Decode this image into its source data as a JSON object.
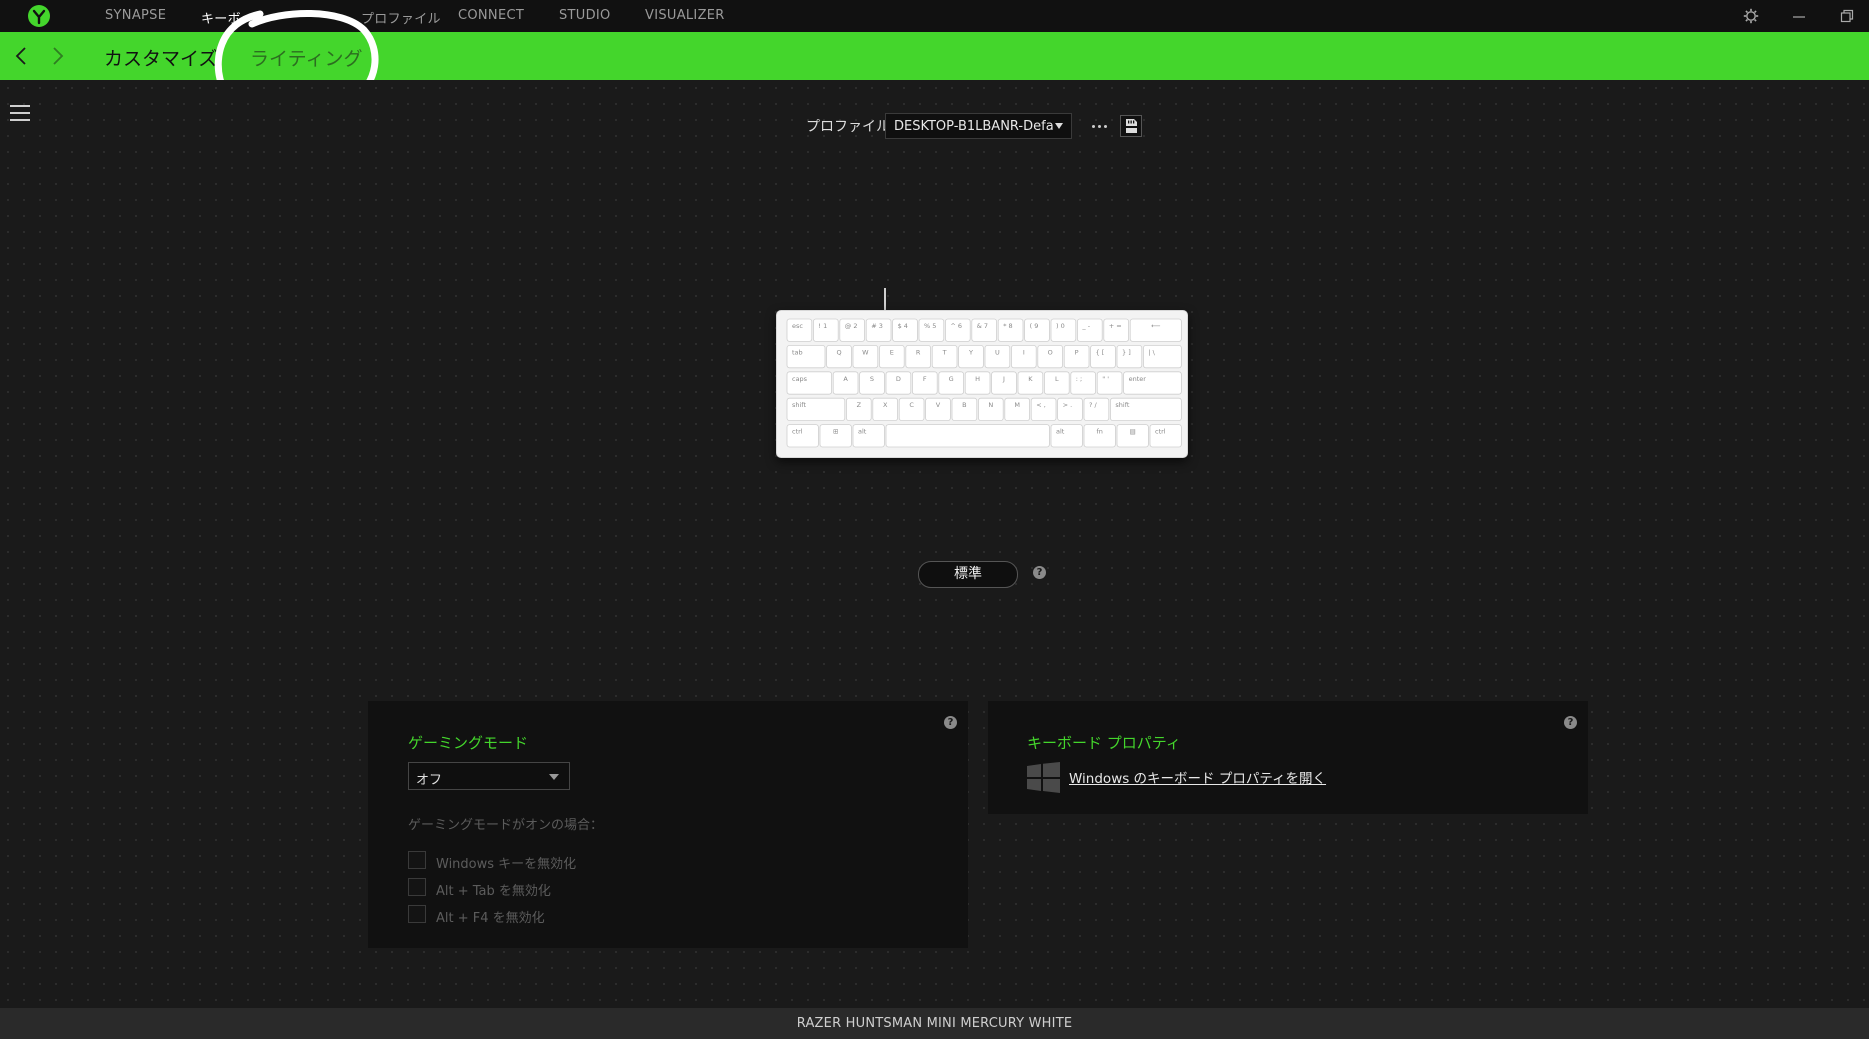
{
  "nav": {
    "items": [
      {
        "label": "SYNAPSE"
      },
      {
        "label": "キーボー"
      },
      {
        "label": "プロファイル"
      },
      {
        "label": "CONNECT"
      },
      {
        "label": "STUDIO"
      },
      {
        "label": "VISUALIZER"
      }
    ]
  },
  "subnav": {
    "tabs": [
      {
        "label": "カスタマイズ"
      },
      {
        "label": "ライティング"
      }
    ]
  },
  "profile": {
    "label": "プロファイル",
    "selected": "DESKTOP-B1LBANR-Defa"
  },
  "keyboard": {
    "rows": [
      [
        "esc",
        "! 1",
        "@ 2",
        "# 3",
        "$ 4",
        "% 5",
        "^ 6",
        "& 7",
        "* 8",
        "( 9",
        ") 0",
        "_ -",
        "+ =",
        "⟵"
      ],
      [
        "tab",
        "Q",
        "W",
        "E",
        "R",
        "T",
        "Y",
        "U",
        "I",
        "O",
        "P",
        "{ [",
        "} ]",
        "| \\"
      ],
      [
        "caps",
        "A",
        "S",
        "D",
        "F",
        "G",
        "H",
        "J",
        "K",
        "L",
        ": ;",
        "\" '",
        "enter"
      ],
      [
        "shift",
        "Z",
        "X",
        "C",
        "V",
        "B",
        "N",
        "M",
        "< ,",
        "> .",
        "? /",
        "shift"
      ],
      [
        "ctrl",
        "⊞",
        "alt",
        "",
        "alt",
        "fn",
        "▤",
        "ctrl"
      ]
    ]
  },
  "mode_button": "標準",
  "gaming_mode": {
    "title": "ゲーミングモード",
    "selected": "オフ",
    "caption": "ゲーミングモードがオンの場合：",
    "options": [
      {
        "label": "Windows キーを無効化",
        "checked": false
      },
      {
        "label": "Alt + Tab を無効化",
        "checked": false
      },
      {
        "label": "Alt + F4 を無効化",
        "checked": false
      }
    ]
  },
  "keyboard_properties": {
    "title": "キーボード プロパティ",
    "link": "Windows のキーボード プロパティを開く"
  },
  "help_glyph": "?",
  "footer": {
    "device_name": "RAZER HUNTSMAN MINI MERCURY WHITE"
  },
  "colors": {
    "accent": "#44d62c",
    "background": "#1a1a1a",
    "panel": "#111111"
  },
  "icons": [
    "razer-logo-icon",
    "settings-icon",
    "minimize-icon",
    "maximize-icon",
    "back-arrow-icon",
    "forward-arrow-icon",
    "hamburger-menu-icon",
    "more-options-icon",
    "onboard-memory-icon",
    "help-icon",
    "windows-logo-icon",
    "chevron-down-icon"
  ]
}
